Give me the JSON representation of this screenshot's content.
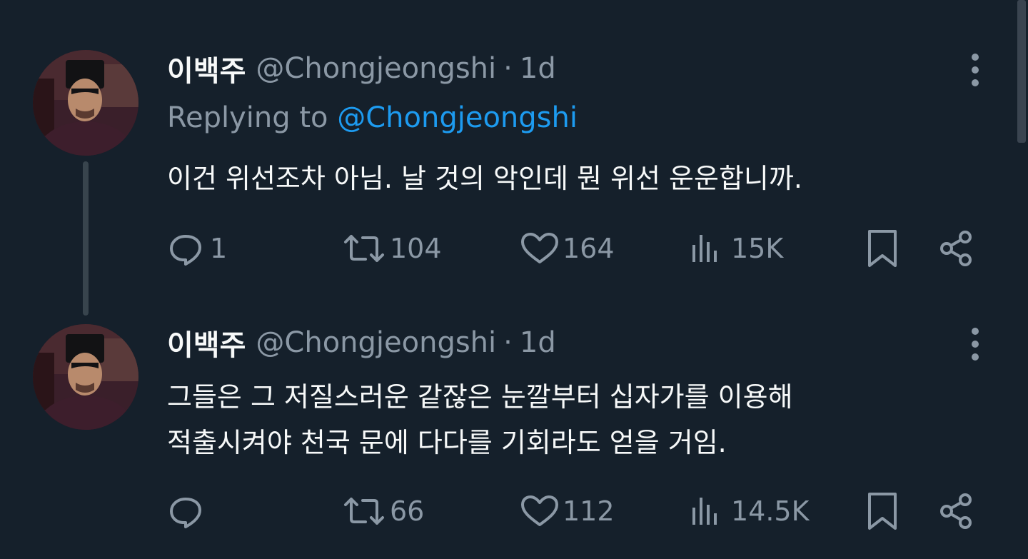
{
  "tweets": [
    {
      "display_name": "이백주",
      "handle": "@Chongjeongshi",
      "dot": "·",
      "time": "1d",
      "replying_prefix": "Replying to",
      "replying_handle": "@Chongjeongshi",
      "text_lines": [
        "이건 위선조차 아님. 날 것의 악인데 뭔 위선 운운합니까."
      ],
      "replies": "1",
      "retweets": "104",
      "likes": "164",
      "views": "15K"
    },
    {
      "display_name": "이백주",
      "handle": "@Chongjeongshi",
      "dot": "·",
      "time": "1d",
      "text_lines": [
        "그들은 그 저질스러운 같잖은 눈깔부터 십자가를 이용해",
        "적출시켜야 천국 문에 다다를 기회라도 얻을 거임."
      ],
      "replies": "",
      "retweets": "66",
      "likes": "112",
      "views": "14.5K"
    }
  ],
  "icons": {
    "more": "more-vertical-icon",
    "reply": "reply-icon",
    "retweet": "retweet-icon",
    "like": "heart-icon",
    "views": "views-icon",
    "bookmark": "bookmark-icon",
    "share": "share-icon"
  },
  "colors": {
    "background": "#15202b",
    "text": "#f7f9f9",
    "muted": "#8b98a5",
    "link": "#1d9bf0",
    "thread_line": "#38444d"
  }
}
